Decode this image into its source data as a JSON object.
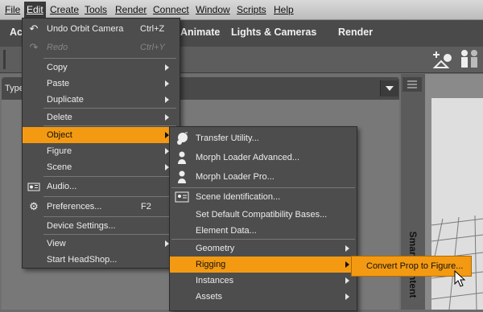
{
  "menubar": {
    "items": [
      "File",
      "Edit",
      "Create",
      "Tools",
      "Render",
      "Connect",
      "Window",
      "Scripts",
      "Help"
    ]
  },
  "tabs": [
    "Ac",
    "Animate",
    "Lights & Cameras",
    "Render"
  ],
  "pane": {
    "type_label": "Type"
  },
  "side_strip": {
    "label": "Smart Content"
  },
  "edit_menu": {
    "items": [
      {
        "label": "Undo Orbit Camera",
        "shortcut": "Ctrl+Z",
        "icon": "undo-icon"
      },
      {
        "label": "Redo",
        "shortcut": "Ctrl+Y",
        "icon": "redo-icon",
        "disabled": true
      },
      {
        "label": "Copy"
      },
      {
        "label": "Paste"
      },
      {
        "label": "Duplicate"
      },
      {
        "label": "Delete"
      },
      {
        "label": "Object"
      },
      {
        "label": "Figure"
      },
      {
        "label": "Scene"
      },
      {
        "label": "Audio...",
        "icon": "audio-icon"
      },
      {
        "label": "Preferences...",
        "shortcut": "F2",
        "icon": "preferences-gear-icon"
      },
      {
        "label": "Device Settings..."
      },
      {
        "label": "View"
      },
      {
        "label": "Start HeadShop..."
      }
    ]
  },
  "object_menu": {
    "items": [
      {
        "label": "Transfer Utility...",
        "icon": "transfer-utility-icon"
      },
      {
        "label": "Morph Loader Advanced...",
        "icon": "morph-loader-advanced-icon"
      },
      {
        "label": "Morph Loader Pro...",
        "icon": "morph-loader-pro-icon"
      },
      {
        "label": "Scene Identification...",
        "icon": "scene-identification-icon"
      },
      {
        "label": "Set Default Compatibility Bases..."
      },
      {
        "label": "Element Data..."
      },
      {
        "label": "Geometry"
      },
      {
        "label": "Rigging"
      },
      {
        "label": "Instances"
      },
      {
        "label": "Assets"
      }
    ]
  },
  "rigging_menu": {
    "items": [
      {
        "label": "Convert Prop to Figure..."
      }
    ]
  },
  "colors": {
    "highlight": "#f39a12",
    "menu_bg": "#4d4d4d",
    "menubar_bg": "#cccccc"
  }
}
